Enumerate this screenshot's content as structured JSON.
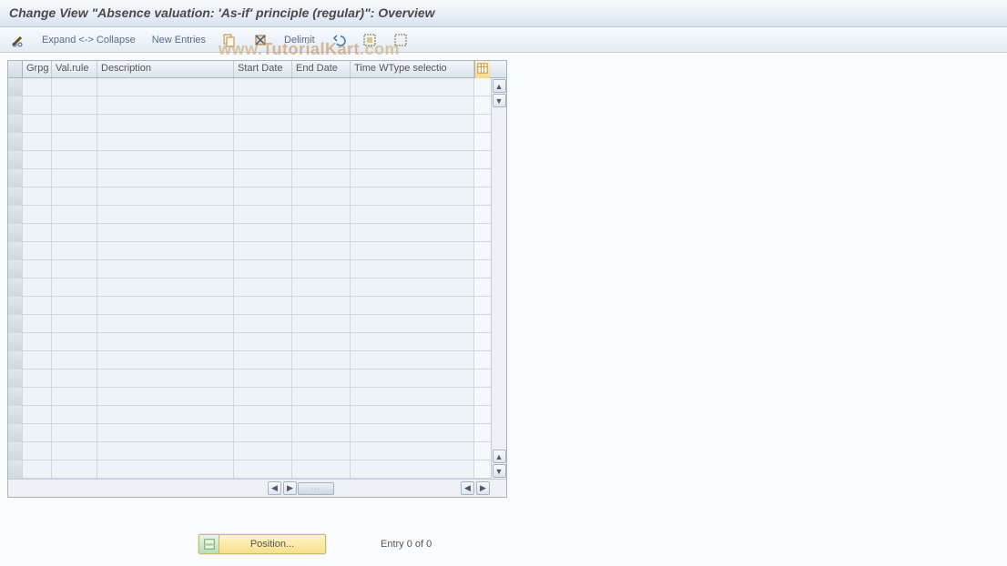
{
  "title": "Change View \"Absence valuation: 'As-if' principle (regular)\": Overview",
  "toolbar": {
    "expand_collapse_label": "Expand <-> Collapse",
    "new_entries_label": "New Entries",
    "delimit_label": "Delimit"
  },
  "grid": {
    "columns": {
      "grpg": "Grpg",
      "rule": "Val.rule",
      "desc": "Description",
      "start": "Start Date",
      "end": "End Date",
      "time": "Time WType selectio"
    },
    "row_count": 22
  },
  "footer": {
    "position_label": "Position...",
    "entry_text": "Entry 0 of 0"
  },
  "watermark": {
    "prefix": "www.",
    "main": "TutorialKart",
    "suffix": ".com"
  }
}
